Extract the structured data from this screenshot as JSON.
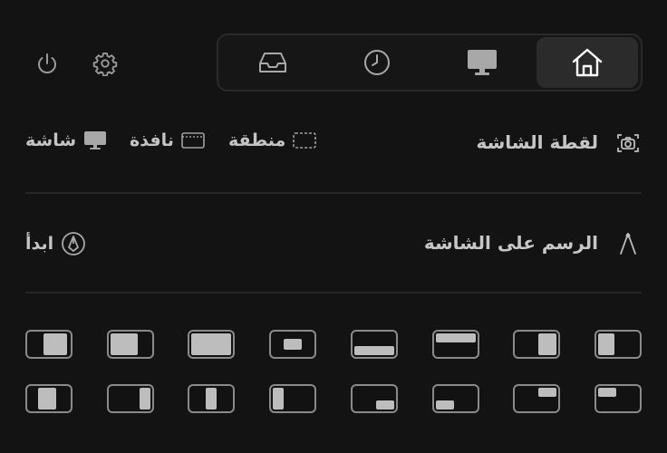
{
  "window_controls": {
    "power_icon": "power-icon",
    "settings_icon": "gear-icon"
  },
  "tabs": [
    {
      "id": "home",
      "icon": "home-icon",
      "active": true
    },
    {
      "id": "display",
      "icon": "monitor-icon",
      "active": false
    },
    {
      "id": "history",
      "icon": "clock-icon",
      "active": false
    },
    {
      "id": "inbox",
      "icon": "tray-icon",
      "active": false
    }
  ],
  "screenshot": {
    "label": "لقطة الشاشة",
    "icon": "camera-icon",
    "options": [
      {
        "label": "منطقة",
        "icon": "dashed-region-icon"
      },
      {
        "label": "نافذة",
        "icon": "window-icon"
      },
      {
        "label": "شاشة",
        "icon": "monitor-icon"
      }
    ]
  },
  "drawing": {
    "label": "الرسم على الشاشة",
    "icon": "compass-icon",
    "start_label": "ابدأ",
    "start_icon": "pen-nib-icon"
  },
  "layouts": {
    "row1": [
      "left-half",
      "left-half-inset",
      "maximize",
      "center-small",
      "bottom-half",
      "top-half",
      "right-half",
      "left-narrow"
    ],
    "row2": [
      "left-third-inset",
      "right-third",
      "center-third",
      "left-third",
      "bottom-right-quarter",
      "bottom-left-quarter",
      "top-right-quarter",
      "top-left-quarter"
    ]
  },
  "colors": {
    "background": "#131313",
    "active_tab": "#2b2b2b",
    "text": "#c6c6c6"
  }
}
